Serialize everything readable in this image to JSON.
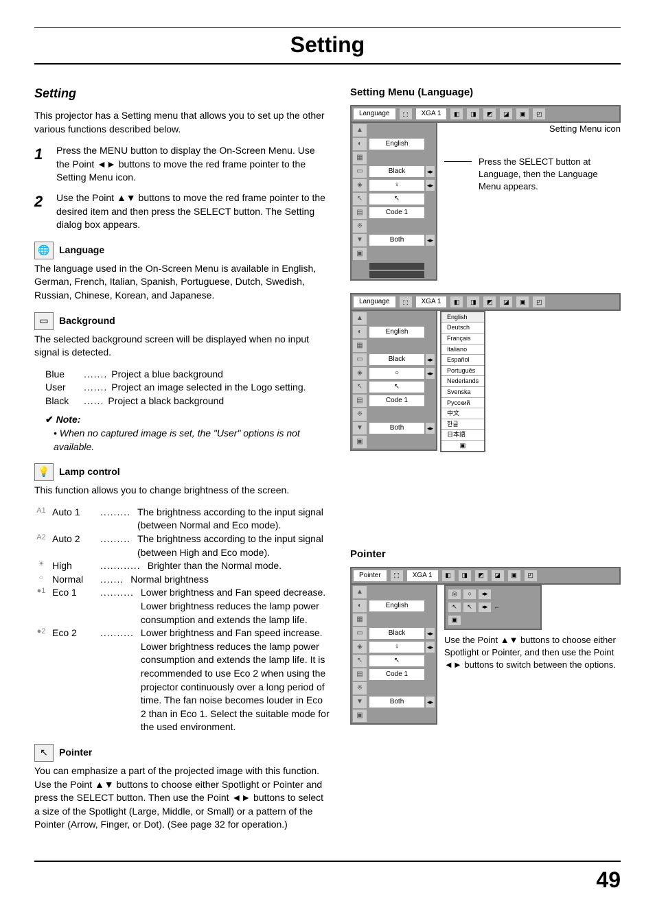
{
  "page": {
    "title": "Setting",
    "number": "49"
  },
  "left": {
    "section": "Setting",
    "intro": "This projector has a Setting menu that allows you to set up the other various functions described below.",
    "step1_num": "1",
    "step1_text": "Press the MENU button to display the On-Screen Menu. Use the Point ◄► buttons to move the red frame pointer to the Setting Menu icon.",
    "step2_num": "2",
    "step2_text": "Use the Point ▲▼ buttons to move the red frame pointer to the desired item and then press the SELECT button. The Setting dialog box appears.",
    "lang_head": "Language",
    "lang_body": "The language used in the On-Screen Menu is available in English, German, French, Italian, Spanish, Portuguese, Dutch, Swedish, Russian, Chinese, Korean, and Japanese.",
    "bg_head": "Background",
    "bg_body": "The selected background screen will be displayed when no input signal is detected.",
    "bg_items": [
      {
        "term": "Blue",
        "dots": ".......",
        "desc": "Project a blue background"
      },
      {
        "term": "User",
        "dots": ".......",
        "desc": "Project an image selected in the Logo setting."
      },
      {
        "term": "Black",
        "dots": "......",
        "desc": "Project a black background"
      }
    ],
    "note_head": "Note:",
    "note_body": "• When no captured image is set, the \"User\" options is not available.",
    "lamp_head": "Lamp control",
    "lamp_body": "This function allows you to change brightness of the screen.",
    "lamp_items": [
      {
        "icon": "A1",
        "term": "Auto 1",
        "dots": ".........",
        "desc": "The brightness according to the input signal (between Normal and Eco mode)."
      },
      {
        "icon": "A2",
        "term": "Auto 2",
        "dots": ".........",
        "desc": "The brightness according to the input signal (between High and Eco mode)."
      },
      {
        "icon": "☀",
        "term": "High",
        "dots": "............",
        "desc": "Brighter than the Normal mode."
      },
      {
        "icon": "○",
        "term": "Normal",
        "dots": ".......",
        "desc": "Normal brightness"
      },
      {
        "icon": "●1",
        "term": "Eco 1",
        "dots": "..........",
        "desc": "Lower brightness and Fan speed decrease. Lower brightness reduces the lamp power consumption and extends the lamp life."
      },
      {
        "icon": "●2",
        "term": "Eco 2",
        "dots": "..........",
        "desc": "Lower brightness and Fan speed increase. Lower brightness reduces the lamp power consumption and extends the lamp life. It is recommended to use Eco 2 when using the projector continuously over a long period of time. The fan noise becomes louder in Eco 2 than in Eco 1. Select the suitable mode for the used environment."
      }
    ],
    "ptr_head": "Pointer",
    "ptr_body": "You can emphasize a part of the projected image with this function. Use the Point ▲▼ buttons to choose either Spotlight or Pointer and press the SELECT button. Then use the Point ◄► buttons to select a size of the Spotlight (Large, Middle, or Small) or a pattern of the Pointer (Arrow, Finger, or Dot). (See page 32 for operation.)"
  },
  "right": {
    "menu1_title": "Setting Menu (Language)",
    "callout_icon": "Setting Menu icon",
    "callout_select": "Press the SELECT button at Language, then the Language Menu appears.",
    "menu_header_label": "Language",
    "menu_header_sys": "XGA 1",
    "menu_vals": [
      "English",
      "",
      "Black",
      "",
      "",
      "Code 1",
      "",
      "Both"
    ],
    "menu_icons": [
      "▲",
      "◐",
      "▦",
      "▭",
      "◈",
      "↖",
      "▤",
      "※",
      "▼",
      "▣"
    ],
    "lang_list": [
      "English",
      "Deutsch",
      "Français",
      "Italiano",
      "Español",
      "Português",
      "Nederlands",
      "Svenska",
      "Русский",
      "中文",
      "한글",
      "日本語"
    ],
    "pointer_title": "Pointer",
    "pointer_header_label": "Pointer",
    "pointer_note": "Use the Point ▲▼ buttons to choose either Spotlight or Pointer, and then use the Point ◄► buttons to switch between the options."
  }
}
